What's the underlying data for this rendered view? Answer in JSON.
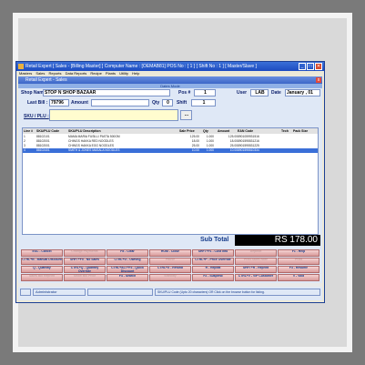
{
  "window": {
    "title": "Retail Expert [ Sales - [Billing Master] ] Computer Name : [OEMAB81] POS No : [ 1 ] [ Shift No : 1 ] [ Master/Slave ]",
    "minimize": "_",
    "maximize": "□",
    "close": "✕"
  },
  "menu": [
    "Masters",
    "Sales",
    "Reports",
    "Data Reports",
    "Recipe",
    "Plants",
    "Utility",
    "Help"
  ],
  "form": {
    "title": "Retail Expert - Sales",
    "close": "x",
    "mode_label": "Dates Mode",
    "shop_name_label": "Shop Name",
    "shop_name_value": "STOP N SHOP BAZAAR",
    "pos_label": "Pos #",
    "pos_value": "1",
    "user_label": "User",
    "user_value": "LAB",
    "date_label": "Date",
    "date_value": "January , 01",
    "last_bill_label": "Last Bill :",
    "last_bill_value": "79796",
    "amount_label": "Amount",
    "qty_label": "Qty",
    "qty_value": "0",
    "shift_label": "Shift",
    "shift_value": "1",
    "sku_label": "SKU / PLU :",
    "sku_value": "",
    "browse_label": "..."
  },
  "table": {
    "headers": [
      "Line #",
      "SKU/PLU Code",
      "SKU/PLU Description",
      "Sale Price",
      "Qty",
      "Amount",
      "EAN Code",
      "Tech",
      "Pack Size"
    ],
    "rows": [
      [
        "1",
        "88102101",
        "MAMA MARIA FUSILLI PASTA 500GM",
        "125.00",
        "1.000",
        "125.00",
        "8901059931516",
        "",
        ""
      ],
      [
        "2",
        "88102001",
        "CHINGS HAKKA RED NOODLES",
        "18.00",
        "1.000",
        "18.00",
        "8901595531216",
        "",
        ""
      ],
      [
        "3",
        "88102001",
        "CHINGS HAKKA EGG NOODLES",
        "25.00",
        "1.000",
        "25.00",
        "8901595531225",
        "",
        ""
      ],
      [
        "4",
        "88102401",
        "SMITH & JONES MASALA NOODLES",
        "10.00",
        "1.000",
        "10.00",
        "8901595510334",
        "",
        ""
      ]
    ],
    "selected_index": 3
  },
  "subtotal": {
    "label": "Sub Total",
    "value": "RS 178.00"
  },
  "buttons": [
    [
      "ESC - Cancel",
      "Change Payments",
      "F8 - Clear",
      "HOM - Close",
      "SHFT+F1 - Cust Info",
      "Deposit",
      "F1 - Help"
    ],
    [
      "CTRL+B - Manual Discount",
      "SHFT+F5 - No Sales",
      "CTRL+G - Owning",
      "Pause",
      "CTRL+P - Price Override",
      "Print Sales Note",
      "Print"
    ],
    [
      "Q - Quantity",
      "CTRL+Q - Quantity Override",
      "CTRL+ALT+F3 - Quick Discount",
      "CTRL+X - Refund",
      "R - Repeat",
      "SHFT+R - Reprint",
      "F3 - Resume"
    ],
    [
      "Sales Bill Reprint",
      "Show Bill Price",
      "F4 - Search",
      "Standby",
      "F2 - Suspend",
      "CTRL+V - VIP Customer",
      "V - Void"
    ]
  ],
  "status": {
    "user_role": "Administrator",
    "hint": "SKU/PLU Code (Upto 20 characters) OR Click on the browse button for listing."
  }
}
